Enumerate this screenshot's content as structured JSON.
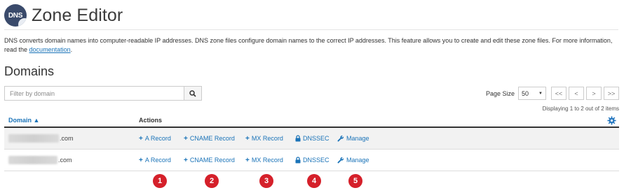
{
  "header": {
    "icon_text": "DNS",
    "title": "Zone Editor"
  },
  "description": {
    "text": "DNS converts domain names into computer-readable IP addresses. DNS zone files configure domain names to the correct IP addresses. This feature allows you to create and edit these zone files. For more information, read the",
    "link": "documentation",
    "end": "."
  },
  "section_title": "Domains",
  "search": {
    "placeholder": "Filter by domain",
    "button_icon": "search-icon"
  },
  "pagination": {
    "page_size_label": "Page Size",
    "page_size_value": "50",
    "buttons": [
      "<<",
      "<",
      ">",
      ">>"
    ],
    "displaying": "Displaying 1 to 2 out of 2 items"
  },
  "table": {
    "col_domain": "Domain ▲",
    "col_actions": "Actions",
    "settings_icon": "gear-icon",
    "rows": [
      {
        "domain_suffix": ".com",
        "actions": {
          "a_record": "A Record",
          "cname_record": "CNAME Record",
          "mx_record": "MX Record",
          "dnssec": "DNSSEC",
          "manage": "Manage"
        }
      },
      {
        "domain_suffix": ".com",
        "actions": {
          "a_record": "A Record",
          "cname_record": "CNAME Record",
          "mx_record": "MX Record",
          "dnssec": "DNSSEC",
          "manage": "Manage"
        }
      }
    ]
  },
  "callouts": [
    "1",
    "2",
    "3",
    "4",
    "5"
  ],
  "colors": {
    "link": "#1a73b8",
    "badge": "#d5202a",
    "row_stripe": "#f2f2f2"
  }
}
